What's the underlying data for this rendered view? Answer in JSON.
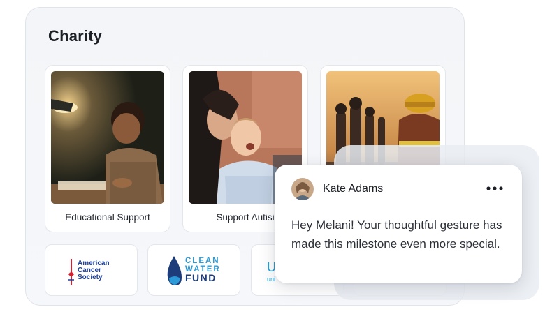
{
  "charity": {
    "title": "Charity",
    "cards": [
      {
        "label": "Educational Support"
      },
      {
        "label": "Support Autisi"
      },
      {
        "label": ""
      }
    ],
    "logos": {
      "acs": {
        "line1": "American",
        "line2": "Cancer",
        "line3": "Society"
      },
      "clean_water": {
        "line1": "CLEAN",
        "line2": "WATER",
        "line3": "FUND"
      },
      "unicef": {
        "mark": "U",
        "text": "uni"
      }
    }
  },
  "chat": {
    "name": "Kate Adams",
    "message": "Hey Melani! Your thoughtful gesture has made this milestone even more special.",
    "more_icon": "more-horizontal-icon"
  },
  "colors": {
    "panel_bg": "#f3f5f8",
    "text_dark": "#1c1f26",
    "acs_blue": "#1b3f9b",
    "water_blue": "#2b9ad6",
    "unicef_blue": "#1aa3dc"
  }
}
